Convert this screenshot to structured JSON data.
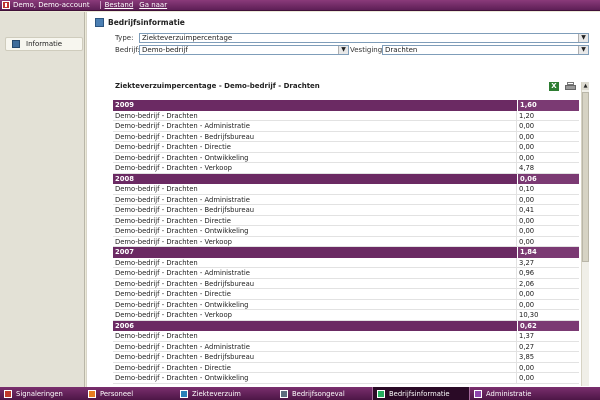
{
  "titlebar": {
    "user": "Demo, Demo-account",
    "menu": [
      "Bestand",
      "Ga naar"
    ]
  },
  "sidebar": {
    "items": [
      {
        "label": "Informatie"
      }
    ]
  },
  "main": {
    "header": "Bedrijfsinformatie",
    "type_label": "Type:",
    "type_value": "Ziekteverzuimpercentage",
    "company_label": "Bedrijf:",
    "company_value": "Demo-bedrijf",
    "location_label": "Vestiging:",
    "location_value": "Drachten",
    "report_title": "Ziekteverzuimpercentage - Demo-bedrijf - Drachten",
    "excel_icon_text": "X"
  },
  "table": {
    "rows": [
      {
        "type": "year",
        "label": "2009",
        "value": "1,60"
      },
      {
        "type": "data",
        "label": "Demo-bedrijf - Drachten",
        "value": "1,20"
      },
      {
        "type": "data",
        "label": "Demo-bedrijf - Drachten - Administratie",
        "value": "0,00"
      },
      {
        "type": "data",
        "label": "Demo-bedrijf - Drachten - Bedrijfsbureau",
        "value": "0,00"
      },
      {
        "type": "data",
        "label": "Demo-bedrijf - Drachten - Directie",
        "value": "0,00"
      },
      {
        "type": "data",
        "label": "Demo-bedrijf - Drachten - Ontwikkeling",
        "value": "0,00"
      },
      {
        "type": "data",
        "label": "Demo-bedrijf - Drachten - Verkoop",
        "value": "4,78"
      },
      {
        "type": "year",
        "label": "2008",
        "value": "0,06"
      },
      {
        "type": "data",
        "label": "Demo-bedrijf - Drachten",
        "value": "0,10"
      },
      {
        "type": "data",
        "label": "Demo-bedrijf - Drachten - Administratie",
        "value": "0,00"
      },
      {
        "type": "data",
        "label": "Demo-bedrijf - Drachten - Bedrijfsbureau",
        "value": "0,41"
      },
      {
        "type": "data",
        "label": "Demo-bedrijf - Drachten - Directie",
        "value": "0,00"
      },
      {
        "type": "data",
        "label": "Demo-bedrijf - Drachten - Ontwikkeling",
        "value": "0,00"
      },
      {
        "type": "data",
        "label": "Demo-bedrijf - Drachten - Verkoop",
        "value": "0,00"
      },
      {
        "type": "year",
        "label": "2007",
        "value": "1,84"
      },
      {
        "type": "data",
        "label": "Demo-bedrijf - Drachten",
        "value": "3,27"
      },
      {
        "type": "data",
        "label": "Demo-bedrijf - Drachten - Administratie",
        "value": "0,96"
      },
      {
        "type": "data",
        "label": "Demo-bedrijf - Drachten - Bedrijfsbureau",
        "value": "2,06"
      },
      {
        "type": "data",
        "label": "Demo-bedrijf - Drachten - Directie",
        "value": "0,00"
      },
      {
        "type": "data",
        "label": "Demo-bedrijf - Drachten - Ontwikkeling",
        "value": "0,00"
      },
      {
        "type": "data",
        "label": "Demo-bedrijf - Drachten - Verkoop",
        "value": "10,30"
      },
      {
        "type": "year",
        "label": "2006",
        "value": "0,62"
      },
      {
        "type": "data",
        "label": "Demo-bedrijf - Drachten",
        "value": "1,37"
      },
      {
        "type": "data",
        "label": "Demo-bedrijf - Drachten - Administratie",
        "value": "0,27"
      },
      {
        "type": "data",
        "label": "Demo-bedrijf - Drachten - Bedrijfsbureau",
        "value": "3,85"
      },
      {
        "type": "data",
        "label": "Demo-bedrijf - Drachten - Directie",
        "value": "0,00"
      },
      {
        "type": "data",
        "label": "Demo-bedrijf - Drachten - Ontwikkeling",
        "value": "0,00"
      }
    ]
  },
  "taskbar": {
    "items": [
      {
        "label": "Signaleringen",
        "icon": "signal-icon",
        "color": "#c0392b",
        "active": false
      },
      {
        "label": "Personeel",
        "icon": "people-icon",
        "color": "#e67e22",
        "active": false
      },
      {
        "label": "Ziekteverzuim",
        "icon": "medical-icon",
        "color": "#2980b9",
        "active": false
      },
      {
        "label": "Bedrijfsongeval",
        "icon": "accident-icon",
        "color": "#5d6d7e",
        "active": false
      },
      {
        "label": "Bedrijfsinformatie",
        "icon": "company-icon",
        "color": "#27ae60",
        "active": true
      },
      {
        "label": "Administratie",
        "icon": "admin-icon",
        "color": "#8e44ad",
        "active": false
      }
    ]
  },
  "colors": {
    "brand": "#6b2a63",
    "year_row": "#6b2a63"
  }
}
